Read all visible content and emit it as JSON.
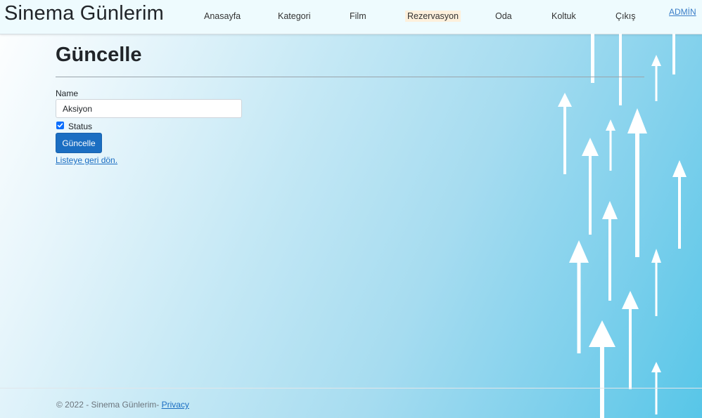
{
  "navbar": {
    "brand": "Sinema Günlerim",
    "links": [
      {
        "label": "Anasayfa",
        "active": false
      },
      {
        "label": "Kategori",
        "active": false
      },
      {
        "label": "Film",
        "active": false
      },
      {
        "label": "Rezervasyon",
        "active": true
      },
      {
        "label": "Oda",
        "active": false
      },
      {
        "label": "Koltuk",
        "active": false
      },
      {
        "label": "Çıkış",
        "active": false
      }
    ],
    "user": "ADMİN"
  },
  "form": {
    "title": "Güncelle",
    "name_label": "Name",
    "name_value": "Aksiyon",
    "status_label": "Status",
    "status_checked": true,
    "submit_label": "Güncelle",
    "back_link": "Listeye geri dön."
  },
  "footer": {
    "text": "© 2022 - Sinema Günlerim-",
    "privacy": "Privacy"
  },
  "colors": {
    "primary": "#1b6ec2",
    "checkbox": "#0d6efd",
    "navbar_bg": "#eefbfe",
    "active_highlight": "#fdf0dc"
  }
}
